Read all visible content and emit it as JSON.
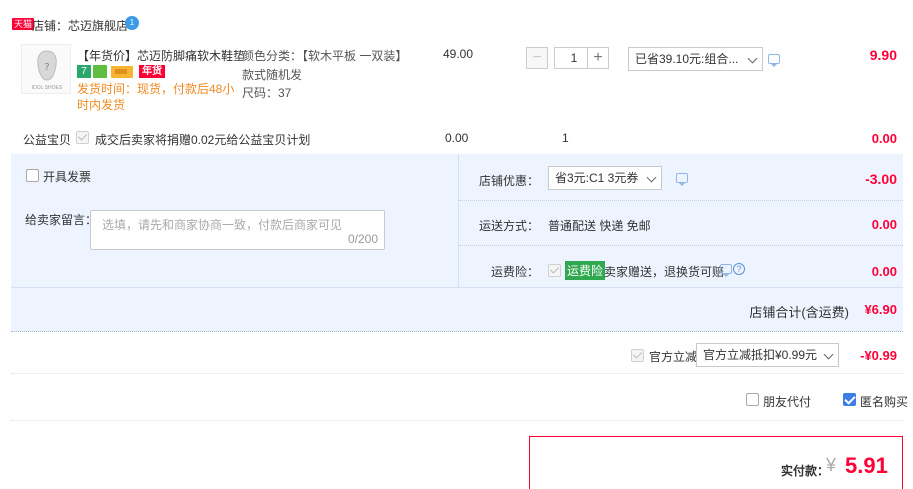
{
  "store": {
    "badge": "天猫",
    "name": "店铺：芯迈旗舰店",
    "chat_badge_count": "1"
  },
  "item": {
    "thumb_caption": "IDOL SHOES",
    "title": "【年货价】芯迈防脚痛软木鞋垫...",
    "tag_7": "7",
    "tag_nianhuo": "年货",
    "delivery": "发货时间：现货，付款后48小时内发货",
    "sku_color": "颜色分类：【软木平板 一双装】",
    "sku_style": "款式随机发",
    "sku_size": "尺码：37",
    "unit_price": "49.00",
    "quantity": "1",
    "promo_select": "已省39.10元:组合...",
    "subtotal": "9.90"
  },
  "charity": {
    "label": "公益宝贝",
    "text": "成交后卖家将捐赠0.02元给公益宝贝计划",
    "price": "0.00",
    "qty": "1",
    "subtotal": "0.00"
  },
  "invoice": {
    "label": "开具发票"
  },
  "message": {
    "label": "给卖家留言：",
    "placeholder": "选填，请先和商家协商一致，付款后商家可见",
    "counter": "0/200"
  },
  "store_coupon": {
    "label": "店铺优惠：",
    "select": "省3元:C1 3元券",
    "amount": "-3.00"
  },
  "shipping": {
    "label": "运送方式：",
    "value": "普通配送 快递 免邮",
    "amount": "0.00"
  },
  "freight_insurance": {
    "label": "运费险：",
    "tag": "运费险",
    "text": "卖家赠送，退换货可赔",
    "amount": "0.00"
  },
  "store_total": {
    "label": "店铺合计(含运费)",
    "value": "¥6.90"
  },
  "official": {
    "label": "官方立减",
    "select": "官方立减抵扣¥0.99元",
    "amount": "-¥0.99"
  },
  "options": {
    "friend_pay": "朋友代付",
    "anonymous": "匿名购买"
  },
  "payment": {
    "label": "实付款：",
    "currency": "¥",
    "amount": "5.91"
  },
  "colors": {
    "accent_red": "#ff0036",
    "panel_blue": "#eef4ff",
    "checkbox_blue": "#3b7de9",
    "freight_green": "#2fa84f"
  }
}
